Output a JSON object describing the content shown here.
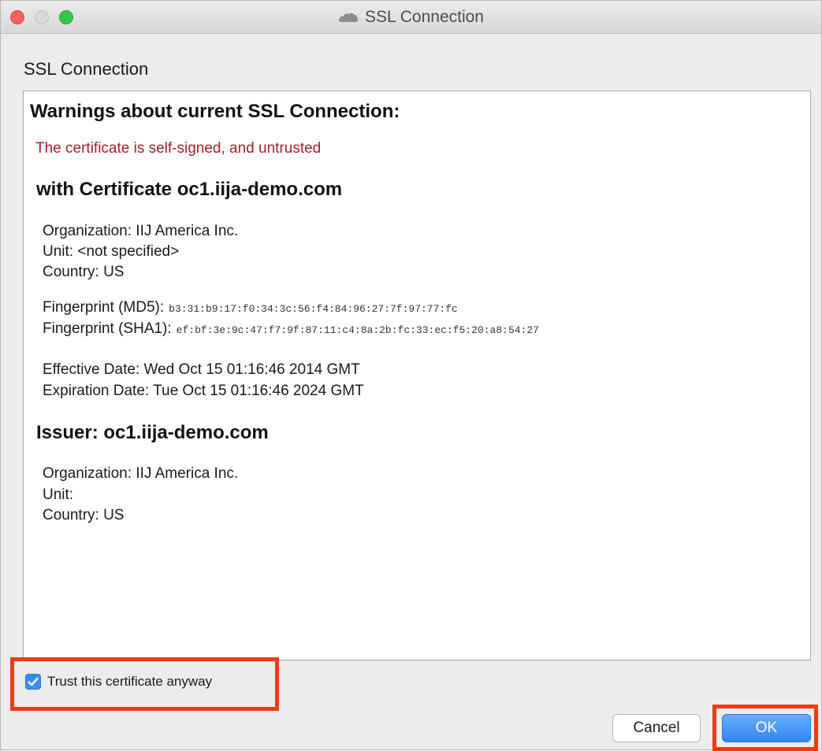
{
  "window": {
    "title": "SSL Connection",
    "title_icon": "cloud-icon",
    "controls": [
      "close",
      "minimize",
      "zoom"
    ]
  },
  "dialog": {
    "heading": "SSL Connection"
  },
  "panel": {
    "warnings_title": "Warnings about current SSL Connection:",
    "warning_message": "The certificate is self-signed, and untrusted",
    "certificate_heading": "with Certificate oc1.iija-demo.com",
    "subject": {
      "organization": "Organization: IIJ America Inc.",
      "unit": "Unit: <not specified>",
      "country": "Country: US"
    },
    "fingerprints": {
      "md5_label": "Fingerprint (MD5):",
      "md5_value": "b3:31:b9:17:f0:34:3c:56:f4:84:96:27:7f:97:77:fc",
      "sha1_label": "Fingerprint (SHA1):",
      "sha1_value": "ef:bf:3e:9c:47:f7:9f:87:11:c4:8a:2b:fc:33:ec:f5:20:a8:54:27"
    },
    "dates": {
      "effective": "Effective Date: Wed Oct 15 01:16:46 2014 GMT",
      "expiration": "Expiration Date: Tue Oct 15 01:16:46 2024 GMT"
    },
    "issuer_heading": "Issuer: oc1.iija-demo.com",
    "issuer": {
      "organization": "Organization: IIJ America Inc.",
      "unit": "Unit:",
      "country": "Country: US"
    }
  },
  "trust": {
    "label": "Trust this certificate anyway",
    "checked": true
  },
  "buttons": {
    "cancel": "Cancel",
    "ok": "OK"
  },
  "colors": {
    "warning_text": "#a3222a",
    "highlight": "#ec3b16",
    "primary_button": "#2f86f5",
    "close_button": "#fc605c",
    "zoom_button": "#34c84a"
  }
}
